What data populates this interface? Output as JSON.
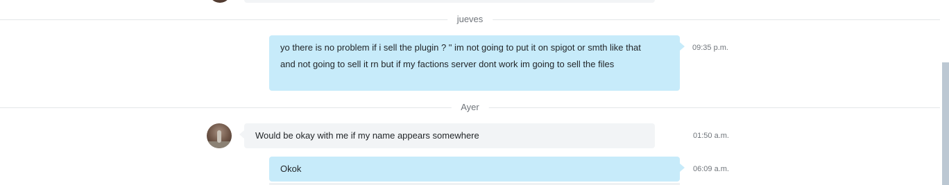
{
  "day_separators": {
    "first": "jueves",
    "second": "Ayer"
  },
  "messages": {
    "out_1": {
      "line_1": "yo there is no problem if i sell the plugin ? \" im not going to put it on spigot or smth like that",
      "line_2": "and not going to sell it rn but if my factions server dont work im going to sell the files",
      "time": "09:35 p.m."
    },
    "in_1": {
      "text": "Would be okay with me if my name appears somewhere",
      "time": "01:50 a.m."
    },
    "out_2": {
      "text": "Okok",
      "time": "06:09 a.m."
    }
  },
  "colors": {
    "outgoing_bubble": "#c7ebfa",
    "incoming_bubble": "#f2f4f6",
    "scrollbar_thumb": "#bcc8d3"
  }
}
